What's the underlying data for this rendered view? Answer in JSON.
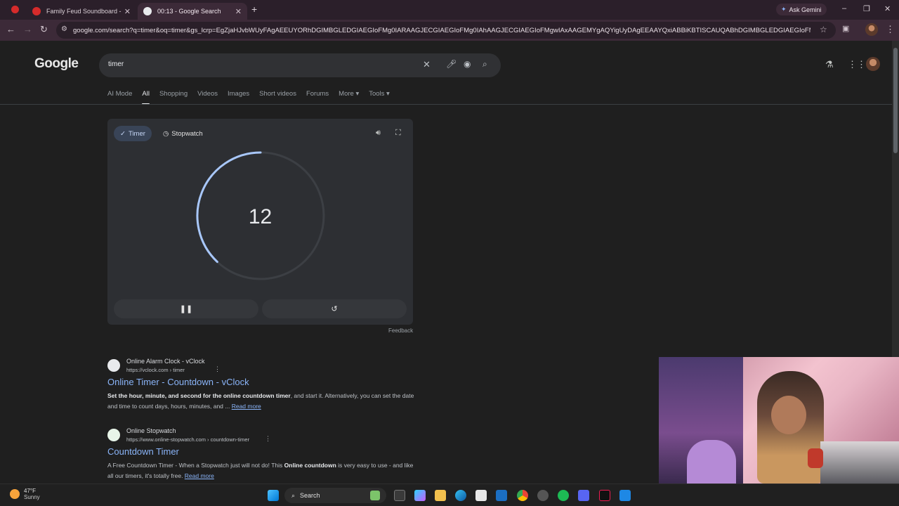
{
  "browser": {
    "tabs": [
      {
        "title": "Family Feud Soundboard - Inst...",
        "favicon_color": "#d62b2b",
        "active": false
      },
      {
        "title": "00:13 - Google Search",
        "favicon_color": "#e8eaed",
        "active": true
      }
    ],
    "new_tab_symbol": "+",
    "ask_gemini_label": "Ask Gemini",
    "url": "google.com/search?q=timer&oq=timer&gs_lcrp=EgZjaHJvbWUyFAgAEEUYORhDGIMBGLEDGIAEGIoFMg0IARAAGJECGIAEGIoFMg0IAhAAGJECGIAEGIoFMgwIAxAAGEMYgAQYigUyDAgEEAAYQxiABBiKBTISCAUQABhDGIMBGLEDGIAEGIoFMgwIBhAAGEMYg..."
  },
  "google": {
    "logo": "Google",
    "query": "timer",
    "search_tabs": [
      {
        "label": "AI Mode",
        "selected": false
      },
      {
        "label": "All",
        "selected": true
      },
      {
        "label": "Shopping",
        "selected": false
      },
      {
        "label": "Videos",
        "selected": false
      },
      {
        "label": "Images",
        "selected": false
      },
      {
        "label": "Short videos",
        "selected": false
      },
      {
        "label": "Forums",
        "selected": false
      },
      {
        "label": "More ▾",
        "selected": false
      },
      {
        "label": "Tools ▾",
        "selected": false
      }
    ]
  },
  "timer_widget": {
    "timer_chip": "Timer",
    "stopwatch_chip": "Stopwatch",
    "remaining_seconds": "12",
    "elapsed_fraction": 0.62,
    "feedback": "Feedback"
  },
  "results": [
    {
      "site": "Online Alarm Clock - vClock",
      "cite": "https://vclock.com › timer",
      "title": "Online Timer - Countdown - vClock",
      "snippet_parts": [
        {
          "b": true,
          "t": "Set the hour, minute, and second for the online countdown timer"
        },
        {
          "b": false,
          "t": ", and start it. Alternatively, you can set the date and time to count days, hours, minutes, and ... "
        }
      ],
      "read_more": "Read more"
    },
    {
      "site": "Online Stopwatch",
      "cite": "https://www.online-stopwatch.com › countdown-timer",
      "title": "Countdown Timer",
      "snippet_parts": [
        {
          "b": false,
          "t": "A Free Countdown Timer - When a Stopwatch just will not do! This "
        },
        {
          "b": true,
          "t": "Online countdown"
        },
        {
          "b": false,
          "t": " is very easy to use - and like all our timers, it's totally free. "
        }
      ],
      "read_more": "Read more"
    }
  ],
  "taskbar": {
    "weather_temp": "47°F",
    "weather_desc": "Sunny",
    "search_label": "Search"
  },
  "colors": {
    "accent_blue": "#8ab4f8",
    "ring_color": "#a8c7fa",
    "browser_frame": "#3c2a38"
  }
}
